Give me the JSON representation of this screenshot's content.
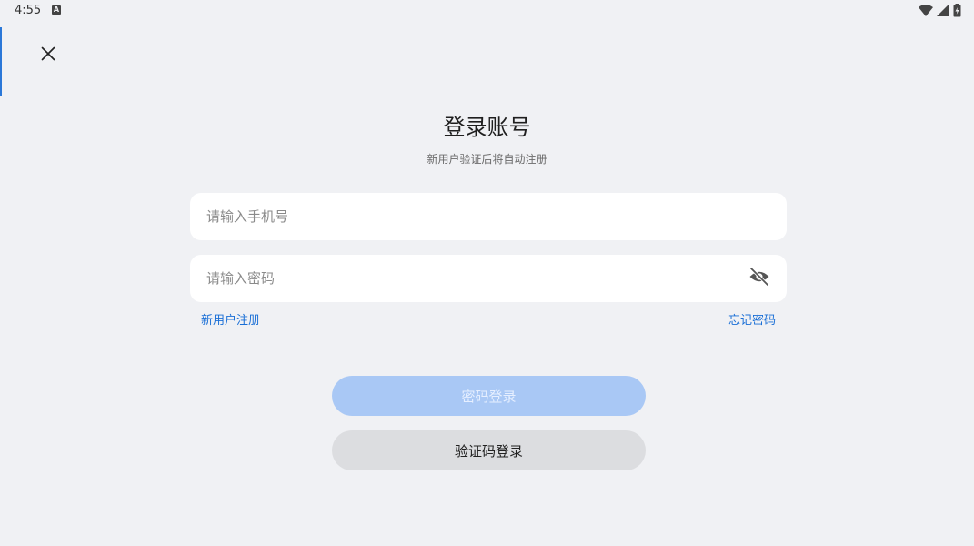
{
  "status_bar": {
    "time": "4:55",
    "notification_letter": "A"
  },
  "header": {
    "title": "登录账号",
    "subtitle": "新用户验证后将自动注册"
  },
  "form": {
    "phone_placeholder": "请输入手机号",
    "phone_value": "",
    "password_placeholder": "请输入密码",
    "password_value": ""
  },
  "links": {
    "register": "新用户注册",
    "forgot_password": "忘记密码"
  },
  "buttons": {
    "password_login": "密码登录",
    "code_login": "验证码登录"
  },
  "colors": {
    "background": "#f0f1f4",
    "link": "#1a6fd6",
    "primary_disabled": "#a9c8f5",
    "secondary_button": "#dcdde0"
  },
  "icons": {
    "close": "close-icon",
    "eye": "eye-off-icon",
    "wifi": "wifi-icon",
    "signal": "signal-icon",
    "battery": "battery-icon"
  }
}
